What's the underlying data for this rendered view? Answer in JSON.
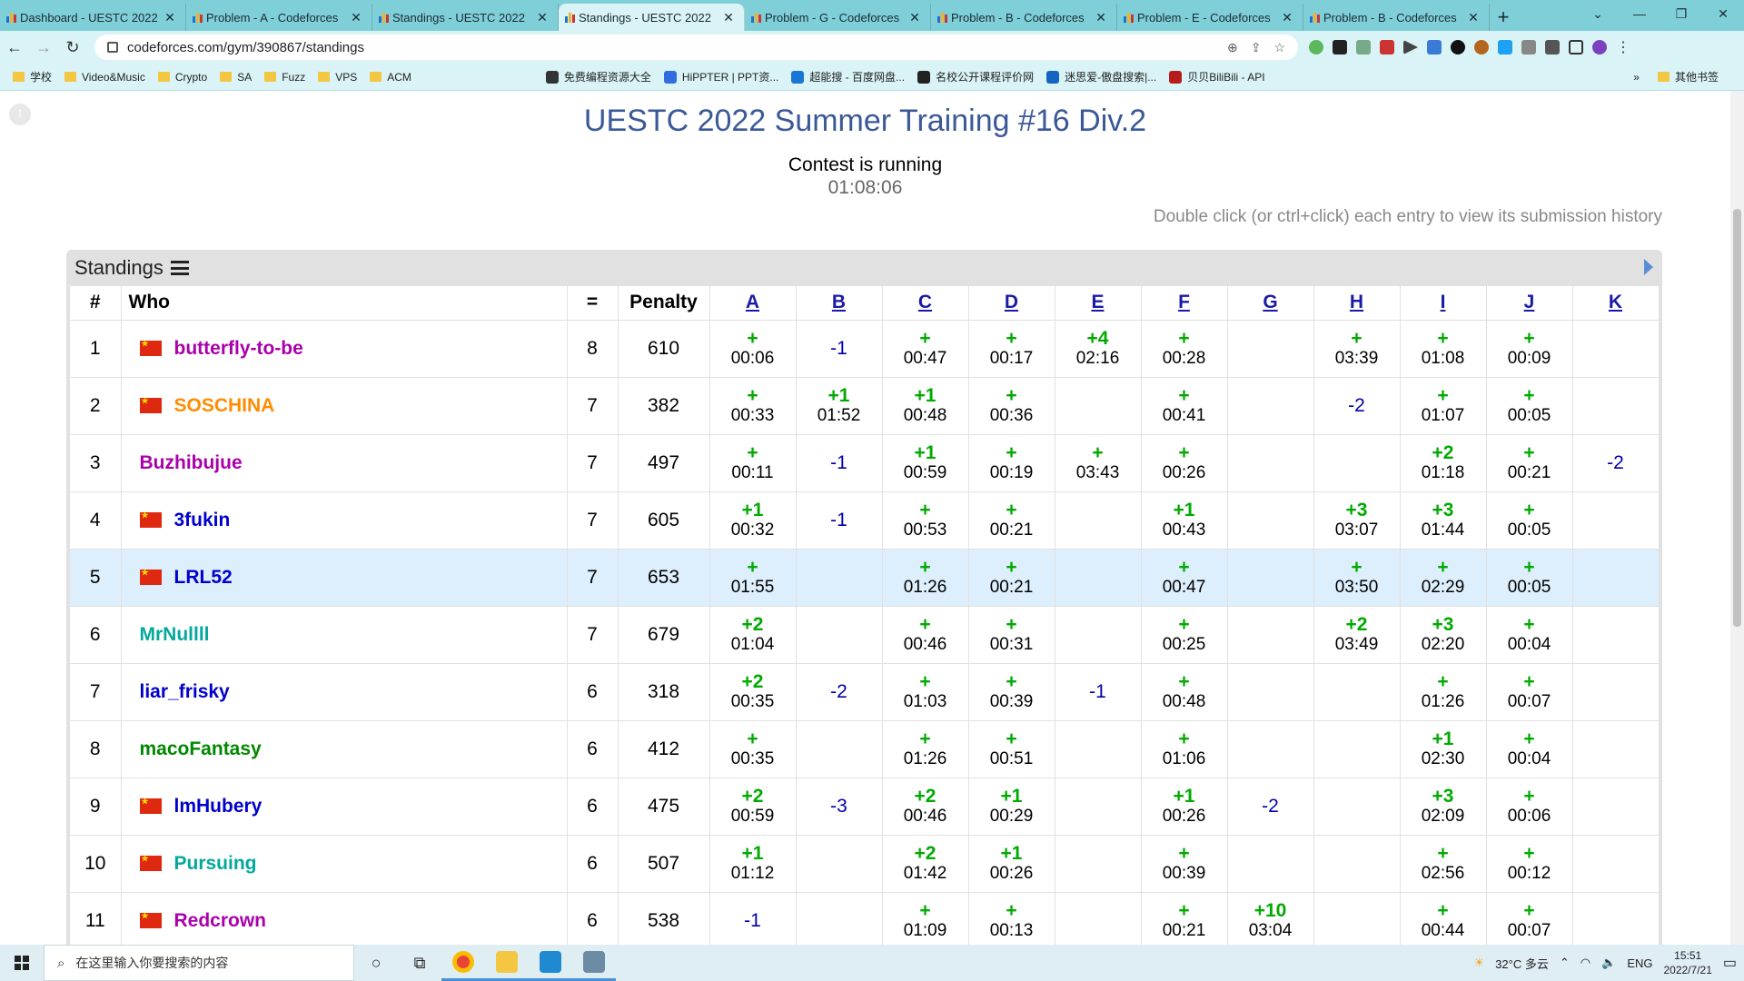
{
  "browser": {
    "tabs": [
      {
        "title": "Dashboard - UESTC 2022",
        "active": false
      },
      {
        "title": "Problem - A - Codeforces",
        "active": false
      },
      {
        "title": "Standings - UESTC 2022",
        "active": false
      },
      {
        "title": "Standings - UESTC 2022",
        "active": true
      },
      {
        "title": "Problem - G - Codeforces",
        "active": false
      },
      {
        "title": "Problem - B - Codeforces",
        "active": false
      },
      {
        "title": "Problem - E - Codeforces",
        "active": false
      },
      {
        "title": "Problem - B - Codeforces",
        "active": false
      }
    ],
    "new_tab": "+",
    "url": "codeforces.com/gym/390867/standings",
    "bookmarks": [
      {
        "label": "学校",
        "type": "folder"
      },
      {
        "label": "Video&Music",
        "type": "folder"
      },
      {
        "label": "Crypto",
        "type": "folder"
      },
      {
        "label": "SA",
        "type": "folder"
      },
      {
        "label": "Fuzz",
        "type": "folder"
      },
      {
        "label": "VPS",
        "type": "folder"
      },
      {
        "label": "ACM",
        "type": "folder"
      }
    ],
    "bookmarks_right": [
      {
        "label": "免费编程资源大全"
      },
      {
        "label": "HiPPTER | PPT资..."
      },
      {
        "label": "超能搜 - 百度网盘..."
      },
      {
        "label": "名校公开课程评价网"
      },
      {
        "label": "迷思爱-傲盘搜索|..."
      },
      {
        "label": "贝贝BiliBili - API"
      }
    ],
    "bookmarks_more": "»",
    "other_bookmarks": "其他书签"
  },
  "page": {
    "contest_title": "UESTC 2022 Summer Training #16 Div.2",
    "status": "Contest is running",
    "timer": "01:08:06",
    "hint": "Double click (or ctrl+click) each entry to view its submission history",
    "panel_title": "Standings",
    "headers": {
      "rank": "#",
      "who": "Who",
      "solved": "=",
      "penalty": "Penalty",
      "problems": [
        "A",
        "B",
        "C",
        "D",
        "E",
        "F",
        "G",
        "H",
        "I",
        "J",
        "K"
      ]
    },
    "rows": [
      {
        "rank": "1",
        "name": "butterfly-to-be",
        "flag": true,
        "color": "#a0a",
        "solved": "8",
        "penalty": "610",
        "highlight": false,
        "cells": [
          [
            "+",
            "00:06"
          ],
          [
            "-1",
            ""
          ],
          [
            "+",
            "00:47"
          ],
          [
            "+",
            "00:17"
          ],
          [
            "+4",
            "02:16"
          ],
          [
            "+",
            "00:28"
          ],
          [
            "",
            ""
          ],
          [
            "+",
            "03:39"
          ],
          [
            "+",
            "01:08"
          ],
          [
            "+",
            "00:09"
          ],
          [
            "",
            ""
          ]
        ]
      },
      {
        "rank": "2",
        "name": "SOSCHINA",
        "flag": true,
        "color": "#ff8c00",
        "solved": "7",
        "penalty": "382",
        "highlight": false,
        "cells": [
          [
            "+",
            "00:33"
          ],
          [
            "+1",
            "01:52"
          ],
          [
            "+1",
            "00:48"
          ],
          [
            "+",
            "00:36"
          ],
          [
            "",
            ""
          ],
          [
            "+",
            "00:41"
          ],
          [
            "",
            ""
          ],
          [
            "-2",
            ""
          ],
          [
            "+",
            "01:07"
          ],
          [
            "+",
            "00:05"
          ],
          [
            "",
            ""
          ]
        ]
      },
      {
        "rank": "3",
        "name": "Buzhibujue",
        "flag": false,
        "color": "#a0a",
        "solved": "7",
        "penalty": "497",
        "highlight": false,
        "cells": [
          [
            "+",
            "00:11"
          ],
          [
            "-1",
            ""
          ],
          [
            "+1",
            "00:59"
          ],
          [
            "+",
            "00:19"
          ],
          [
            "+",
            "03:43"
          ],
          [
            "+",
            "00:26"
          ],
          [
            "",
            ""
          ],
          [
            "",
            ""
          ],
          [
            "+2",
            "01:18"
          ],
          [
            "+",
            "00:21"
          ],
          [
            "-2",
            ""
          ]
        ]
      },
      {
        "rank": "4",
        "name": "3fukin",
        "flag": true,
        "color": "#00c",
        "solved": "7",
        "penalty": "605",
        "highlight": false,
        "cells": [
          [
            "+1",
            "00:32"
          ],
          [
            "-1",
            ""
          ],
          [
            "+",
            "00:53"
          ],
          [
            "+",
            "00:21"
          ],
          [
            "",
            ""
          ],
          [
            "+1",
            "00:43"
          ],
          [
            "",
            ""
          ],
          [
            "+3",
            "03:07"
          ],
          [
            "+3",
            "01:44"
          ],
          [
            "+",
            "00:05"
          ],
          [
            "",
            ""
          ]
        ]
      },
      {
        "rank": "5",
        "name": "LRL52",
        "flag": true,
        "color": "#00c",
        "solved": "7",
        "penalty": "653",
        "highlight": true,
        "cells": [
          [
            "+",
            "01:55"
          ],
          [
            "",
            ""
          ],
          [
            "+",
            "01:26"
          ],
          [
            "+",
            "00:21"
          ],
          [
            "",
            ""
          ],
          [
            "+",
            "00:47"
          ],
          [
            "",
            ""
          ],
          [
            "+",
            "03:50"
          ],
          [
            "+",
            "02:29"
          ],
          [
            "+",
            "00:05"
          ],
          [
            "",
            ""
          ]
        ]
      },
      {
        "rank": "6",
        "name": "MrNullll",
        "flag": false,
        "color": "#03a89e",
        "solved": "7",
        "penalty": "679",
        "highlight": false,
        "cells": [
          [
            "+2",
            "01:04"
          ],
          [
            "",
            ""
          ],
          [
            "+",
            "00:46"
          ],
          [
            "+",
            "00:31"
          ],
          [
            "",
            ""
          ],
          [
            "+",
            "00:25"
          ],
          [
            "",
            ""
          ],
          [
            "+2",
            "03:49"
          ],
          [
            "+3",
            "02:20"
          ],
          [
            "+",
            "00:04"
          ],
          [
            "",
            ""
          ]
        ]
      },
      {
        "rank": "7",
        "name": "liar_frisky",
        "flag": false,
        "color": "#00c",
        "solved": "6",
        "penalty": "318",
        "highlight": false,
        "cells": [
          [
            "+2",
            "00:35"
          ],
          [
            "-2",
            ""
          ],
          [
            "+",
            "01:03"
          ],
          [
            "+",
            "00:39"
          ],
          [
            "-1",
            ""
          ],
          [
            "+",
            "00:48"
          ],
          [
            "",
            ""
          ],
          [
            "",
            ""
          ],
          [
            "+",
            "01:26"
          ],
          [
            "+",
            "00:07"
          ],
          [
            "",
            ""
          ]
        ]
      },
      {
        "rank": "8",
        "name": "macoFantasy",
        "flag": false,
        "color": "#080",
        "solved": "6",
        "penalty": "412",
        "highlight": false,
        "cells": [
          [
            "+",
            "00:35"
          ],
          [
            "",
            ""
          ],
          [
            "+",
            "01:26"
          ],
          [
            "+",
            "00:51"
          ],
          [
            "",
            ""
          ],
          [
            "+",
            "01:06"
          ],
          [
            "",
            ""
          ],
          [
            "",
            ""
          ],
          [
            "+1",
            "02:30"
          ],
          [
            "+",
            "00:04"
          ],
          [
            "",
            ""
          ]
        ]
      },
      {
        "rank": "9",
        "name": "lmHubery",
        "flag": true,
        "color": "#00c",
        "solved": "6",
        "penalty": "475",
        "highlight": false,
        "cells": [
          [
            "+2",
            "00:59"
          ],
          [
            "-3",
            ""
          ],
          [
            "+2",
            "00:46"
          ],
          [
            "+1",
            "00:29"
          ],
          [
            "",
            ""
          ],
          [
            "+1",
            "00:26"
          ],
          [
            "-2",
            ""
          ],
          [
            "",
            ""
          ],
          [
            "+3",
            "02:09"
          ],
          [
            "+",
            "00:06"
          ],
          [
            "",
            ""
          ]
        ]
      },
      {
        "rank": "10",
        "name": "Pursuing",
        "flag": true,
        "color": "#03a89e",
        "solved": "6",
        "penalty": "507",
        "highlight": false,
        "cells": [
          [
            "+1",
            "01:12"
          ],
          [
            "",
            ""
          ],
          [
            "+2",
            "01:42"
          ],
          [
            "+1",
            "00:26"
          ],
          [
            "",
            ""
          ],
          [
            "+",
            "00:39"
          ],
          [
            "",
            ""
          ],
          [
            "",
            ""
          ],
          [
            "+",
            "02:56"
          ],
          [
            "+",
            "00:12"
          ],
          [
            "",
            ""
          ]
        ]
      },
      {
        "rank": "11",
        "name": "Redcrown",
        "flag": true,
        "color": "#a0a",
        "solved": "6",
        "penalty": "538",
        "highlight": false,
        "cells": [
          [
            "-1",
            ""
          ],
          [
            "",
            ""
          ],
          [
            "+",
            "01:09"
          ],
          [
            "+",
            "00:13"
          ],
          [
            "",
            ""
          ],
          [
            "+",
            "00:21"
          ],
          [
            "+10",
            "03:04"
          ],
          [
            "",
            ""
          ],
          [
            "+",
            "00:44"
          ],
          [
            "+",
            "00:07"
          ],
          [
            "",
            ""
          ]
        ]
      }
    ]
  },
  "taskbar": {
    "search_placeholder": "在这里输入你要搜索的内容",
    "weather": "32°C 多云",
    "lang": "ENG",
    "time": "15:51",
    "date": "2022/7/21"
  }
}
